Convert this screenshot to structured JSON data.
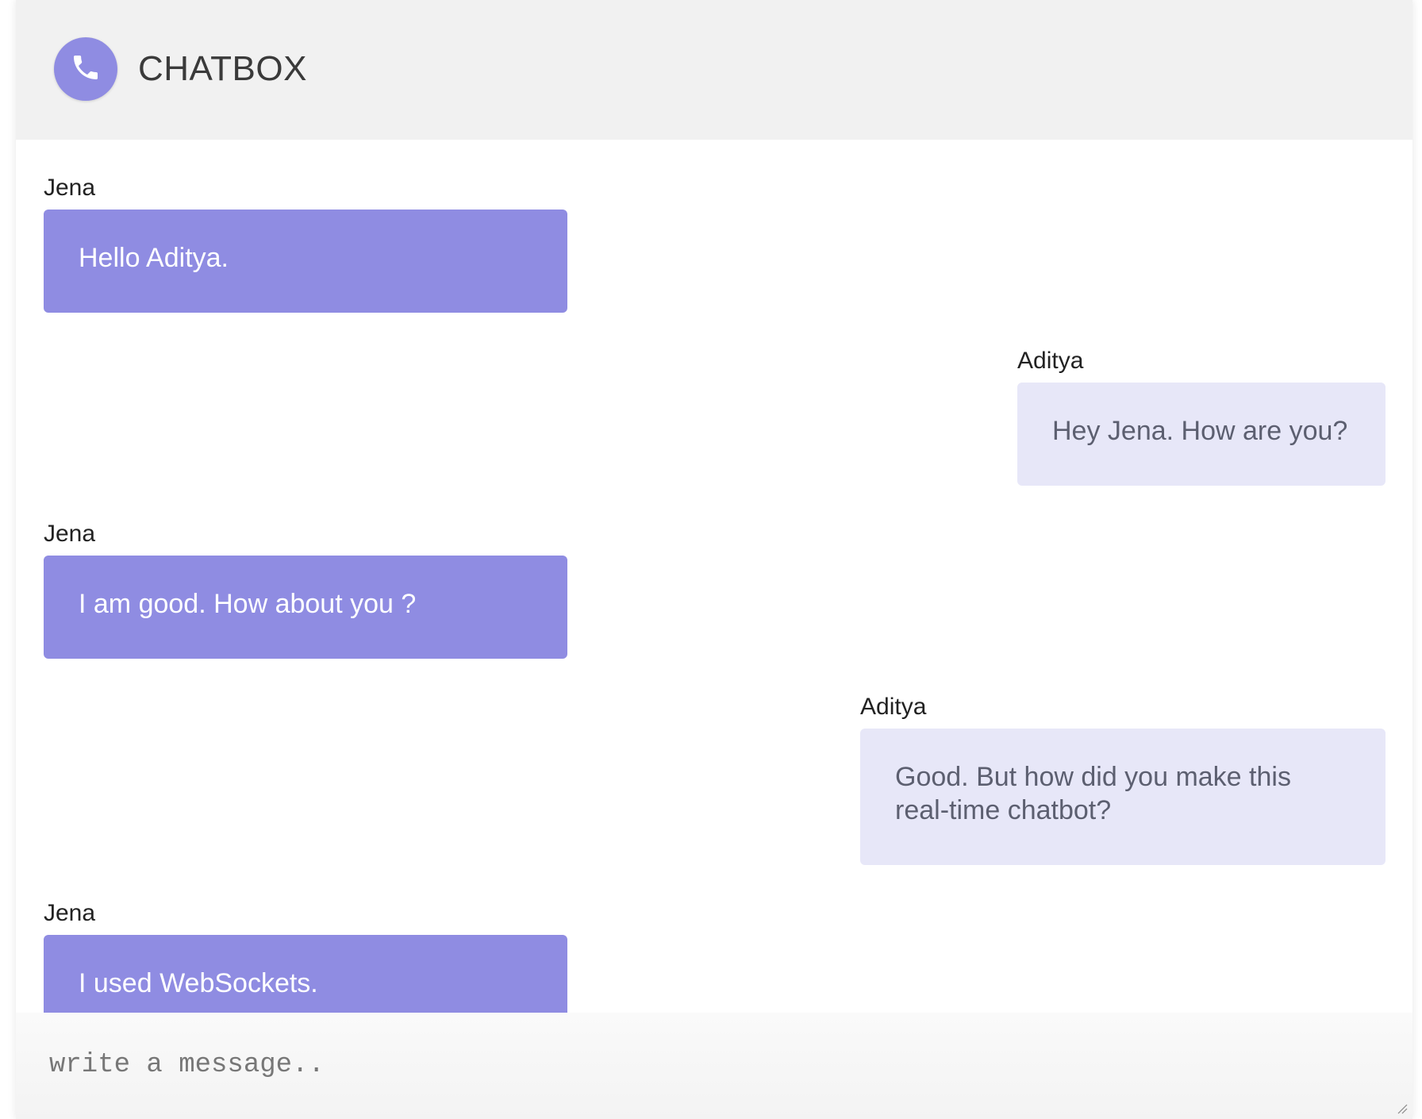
{
  "header": {
    "title": "CHATBOX",
    "call_icon": "phone-icon"
  },
  "colors": {
    "accent": "#8f8ce2",
    "incoming_bubble": "#8f8ce2",
    "outgoing_bubble": "#e7e7f8",
    "header_bg": "#f1f1f1"
  },
  "messages": [
    {
      "sender": "Jena",
      "text": "Hello Aditya.",
      "side": "left"
    },
    {
      "sender": "Aditya",
      "text": "Hey Jena. How are you?",
      "side": "right"
    },
    {
      "sender": "Jena",
      "text": "I am good. How about you ?",
      "side": "left"
    },
    {
      "sender": "Aditya",
      "text": "Good. But how did you make this real-time chatbot?",
      "side": "right"
    },
    {
      "sender": "Jena",
      "text": "I used WebSockets.",
      "side": "left"
    }
  ],
  "composer": {
    "placeholder": "write a message..",
    "value": ""
  }
}
